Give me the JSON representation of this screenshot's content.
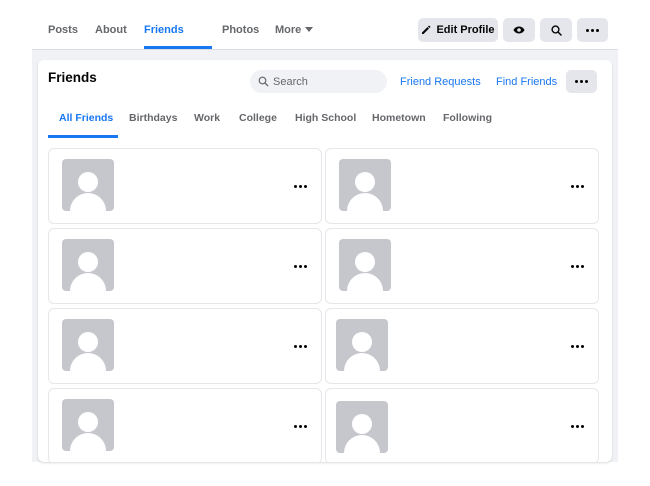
{
  "profile_nav": {
    "tabs": [
      {
        "label": "Posts",
        "active": false
      },
      {
        "label": "About",
        "active": false
      },
      {
        "label": "Friends",
        "active": true
      },
      {
        "label": "Photos",
        "active": false
      },
      {
        "label": "More",
        "active": false
      }
    ],
    "edit_profile_label": "Edit Profile",
    "view_as_icon": "eye-icon",
    "search_icon": "search-icon",
    "more_icon": "ellipsis-icon"
  },
  "friends_card": {
    "title": "Friends",
    "search": {
      "placeholder": "Search",
      "value": ""
    },
    "friend_requests_label": "Friend Requests",
    "find_friends_label": "Find Friends",
    "filter_tabs": [
      {
        "label": "All Friends",
        "active": true
      },
      {
        "label": "Birthdays",
        "active": false
      },
      {
        "label": "Work",
        "active": false
      },
      {
        "label": "College",
        "active": false
      },
      {
        "label": "High School",
        "active": false
      },
      {
        "label": "Hometown",
        "active": false
      },
      {
        "label": "Following",
        "active": false
      }
    ],
    "friends": [
      {
        "name": "",
        "avatar": "default-avatar"
      },
      {
        "name": "",
        "avatar": "default-avatar"
      },
      {
        "name": "",
        "avatar": "default-avatar"
      },
      {
        "name": "",
        "avatar": "default-avatar"
      },
      {
        "name": "",
        "avatar": "default-avatar"
      },
      {
        "name": "",
        "avatar": "default-avatar"
      },
      {
        "name": "",
        "avatar": "default-avatar"
      },
      {
        "name": "",
        "avatar": "default-avatar"
      }
    ]
  },
  "colors": {
    "accent": "#1877f2",
    "button_bg": "#e4e6eb",
    "page_bg": "#f0f2f5",
    "secondary_text": "#65676b",
    "avatar_bg": "#c5c7cc"
  }
}
